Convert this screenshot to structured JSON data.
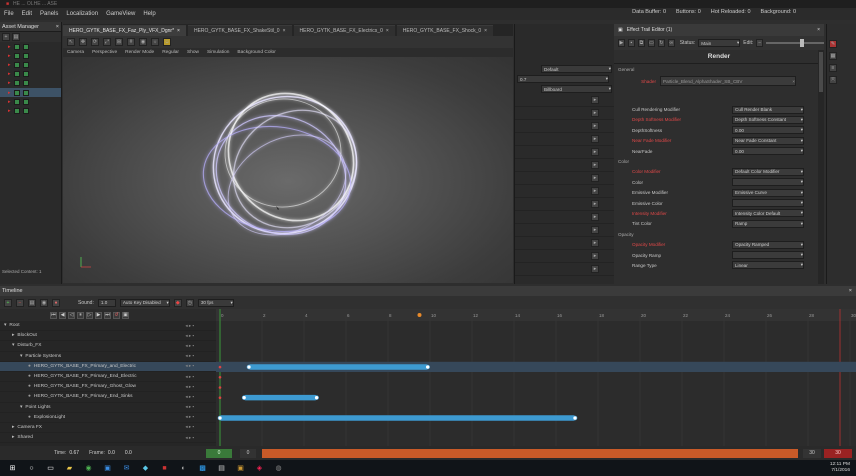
{
  "window": {
    "title": "HE ... OLHE ... ASE"
  },
  "menu": [
    "File",
    "Edit",
    "Panels",
    "Localization",
    "GameView",
    "Help"
  ],
  "stats": {
    "data_label": "Data Buffer",
    "data_value": "0",
    "buttons": "Buttons: 0",
    "hot_reload": "Hot Reloaded: 0",
    "background": "Background: 0"
  },
  "asset_panel": {
    "title": "Asset Manager",
    "collection": "Selected Content: 1",
    "items": 8
  },
  "tabs": [
    {
      "label": "HERO_GYTK_BASE_FX_Faz_Ply_VFX_Dgnr*",
      "active": true
    },
    {
      "label": "HERO_GYTK_BASE_FX_ShakeStil_0",
      "active": false
    },
    {
      "label": "HERO_GYTK_BASE_FX_Electrics_0",
      "active": false
    },
    {
      "label": "HERO_GYTK_BASE_FX_Shock_0",
      "active": false
    }
  ],
  "viewport_modes": [
    "Camera",
    "Perspective",
    "Render Mode",
    "Regular",
    "Show",
    "Simulation",
    "Background Color"
  ],
  "mid_panel": {
    "dropdown1": "Default",
    "field1": "0.7",
    "dropdown2": "Billboard"
  },
  "effect_panel": {
    "title": "Effect Trail Editor (1)",
    "status_label": "Status:",
    "status_value": "Main",
    "edit_label": "Edit:",
    "section": "Render",
    "subsection_general": "General",
    "shader_label": "Shader",
    "shader_value": "Particle_Blend_AlphaShader_SB_CBV",
    "props": [
      {
        "label": "Cull Rendering Modifier",
        "value": "Cull Render Blank",
        "cls": ""
      },
      {
        "label": "Depth Softness Modifier",
        "value": "Depth Softness Constant",
        "cls": "red"
      },
      {
        "label": "DepthSoftness",
        "value": "0.00",
        "cls": ""
      },
      {
        "label": "Near Fade Modifier",
        "value": "Near Fade Constant",
        "cls": "red"
      },
      {
        "label": "NearFade",
        "value": "0.00",
        "cls": ""
      }
    ],
    "color_section": "Color",
    "color_props": [
      {
        "label": "Color Modifier",
        "value": "Default Color Modifier",
        "cls": "red"
      },
      {
        "label": "Color",
        "value": "",
        "cls": ""
      },
      {
        "label": "Emissive Modifier",
        "value": "Emissive Curve",
        "cls": ""
      },
      {
        "label": "Emissive Color",
        "value": "",
        "cls": ""
      },
      {
        "label": "Intensity Modifier",
        "value": "Intensity Color Default",
        "cls": "red"
      },
      {
        "label": "Tint Color",
        "value": "Ramp",
        "cls": ""
      }
    ],
    "opacity_section": "Opacity",
    "opacity_props": [
      {
        "label": "Opacity Modifier",
        "value": "Opacity Ramped",
        "cls": "red"
      },
      {
        "label": "Opacity Ramp",
        "value": "",
        "cls": ""
      },
      {
        "label": "Range Type",
        "value": "Linear",
        "cls": ""
      }
    ]
  },
  "timeline": {
    "title": "Timeline",
    "sound_label": "Sound:",
    "sound_value": "1.0",
    "autokey": "Auto Key Disabled",
    "fps": "30 fps",
    "rows": [
      {
        "label": "Root",
        "indent": 0,
        "icon": "▾"
      },
      {
        "label": "BlockOut",
        "indent": 1,
        "icon": "▸"
      },
      {
        "label": "Disturb_FX",
        "indent": 1,
        "icon": "▾"
      },
      {
        "label": "Particle Systems",
        "indent": 2,
        "icon": "▾"
      },
      {
        "label": "HERO_GYTK_BASE_FX_Primary_and_Electric",
        "indent": 3,
        "icon": "●",
        "sel": true
      },
      {
        "label": "HERO_GYTK_BASE_FX_Primary_End_Electric",
        "indent": 3,
        "icon": "●"
      },
      {
        "label": "HERO_GYTK_BASE_FX_Primary_Ghost_Glow",
        "indent": 3,
        "icon": "●"
      },
      {
        "label": "HERO_GYTK_BASE_FX_Primary_End_Sinks",
        "indent": 3,
        "icon": "●"
      },
      {
        "label": "Point Lights",
        "indent": 2,
        "icon": "▾"
      },
      {
        "label": "ExplosionLight",
        "indent": 3,
        "icon": "●"
      },
      {
        "label": "Camera FX",
        "indent": 1,
        "icon": "▸"
      },
      {
        "label": "Shared",
        "indent": 1,
        "icon": "▸"
      }
    ],
    "ticks": [
      "0",
      "2",
      "4",
      "6",
      "8",
      "10",
      "12",
      "14",
      "16",
      "18",
      "20",
      "22",
      "24",
      "26",
      "28",
      "30"
    ],
    "clips": [
      {
        "row": 4,
        "start": 1.2,
        "end": 8.6
      },
      {
        "row": 7,
        "start": 1.0,
        "end": 4.0
      },
      {
        "row": 9,
        "start": 0.0,
        "end": 14.7
      }
    ],
    "time_label": "Time:",
    "time_value": "0.67",
    "frame_label": "Frame:",
    "frame_value": "0.0",
    "zoom": "0.0",
    "range_start": "0",
    "range_end": "30"
  },
  "taskbar": {
    "time": "12:11 PM",
    "date": "7/1/2016"
  }
}
